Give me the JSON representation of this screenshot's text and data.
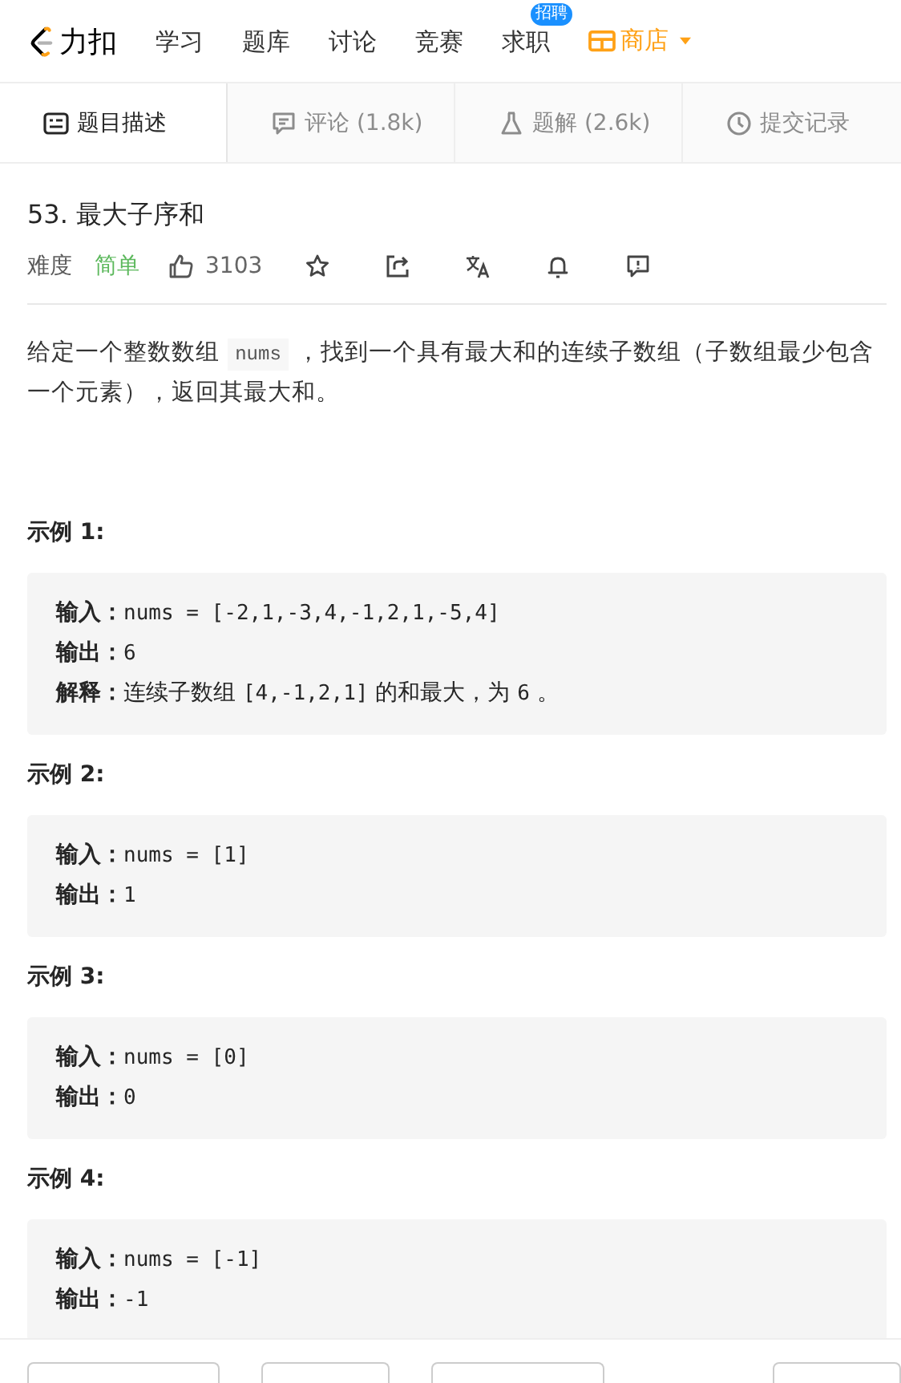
{
  "nav": {
    "logo": "力扣",
    "items": [
      {
        "label": "学习"
      },
      {
        "label": "题库"
      },
      {
        "label": "讨论"
      },
      {
        "label": "竞赛"
      },
      {
        "label": "求职",
        "badge": "招聘"
      }
    ],
    "shop": {
      "label": "商店"
    }
  },
  "tabs": [
    {
      "label": "题目描述",
      "selected": true
    },
    {
      "label": "评论 (1.8k)",
      "selected": false
    },
    {
      "label": "题解 (2.6k)",
      "selected": false
    },
    {
      "label": "提交记录",
      "selected": false
    }
  ],
  "problem": {
    "title": "53. 最大子序和",
    "difficulty_label": "难度",
    "difficulty": "简单",
    "likes": "3103",
    "description": [
      {
        "kind": "text",
        "text": "给定一个整数数组 "
      },
      {
        "kind": "code",
        "text": "nums"
      },
      {
        "kind": "text",
        "text": " ，找到一个具有最大和的连续子数组（子数组最少包含一个元素），返回其最大和。"
      }
    ]
  },
  "examples": [
    {
      "title": "示例 1:",
      "lines": [
        {
          "label": "输入：",
          "parts": [
            {
              "kind": "code",
              "text": "nums = [-2,1,-3,4,-1,2,1,-5,4]"
            }
          ]
        },
        {
          "label": "输出：",
          "parts": [
            {
              "kind": "code",
              "text": "6"
            }
          ]
        },
        {
          "label": "解释：",
          "parts": [
            {
              "kind": "text",
              "text": "连续子数组 "
            },
            {
              "kind": "code",
              "text": "[4,-1,2,1]"
            },
            {
              "kind": "text",
              "text": " 的和最大，为 "
            },
            {
              "kind": "code",
              "text": "6"
            },
            {
              "kind": "text",
              "text": " 。"
            }
          ]
        }
      ]
    },
    {
      "title": "示例 2:",
      "lines": [
        {
          "label": "输入：",
          "parts": [
            {
              "kind": "code",
              "text": "nums = [1]"
            }
          ]
        },
        {
          "label": "输出：",
          "parts": [
            {
              "kind": "code",
              "text": "1"
            }
          ]
        }
      ]
    },
    {
      "title": "示例 3:",
      "lines": [
        {
          "label": "输入：",
          "parts": [
            {
              "kind": "code",
              "text": "nums = [0]"
            }
          ]
        },
        {
          "label": "输出：",
          "parts": [
            {
              "kind": "code",
              "text": "0"
            }
          ]
        }
      ]
    },
    {
      "title": "示例 4:",
      "lines": [
        {
          "label": "输入：",
          "parts": [
            {
              "kind": "code",
              "text": "nums = [-1]"
            }
          ]
        },
        {
          "label": "输出：",
          "parts": [
            {
              "kind": "code",
              "text": "-1"
            }
          ]
        }
      ]
    }
  ]
}
